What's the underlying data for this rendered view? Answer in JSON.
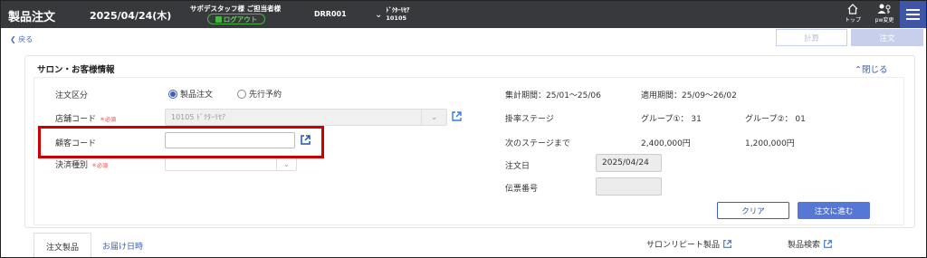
{
  "header": {
    "app_title": "製品注文",
    "date": "2025/04/24(木)",
    "staff": "サポデスタッフ様 ご担当者様",
    "logout_label": "ログアウト",
    "code": "DRR001",
    "store_name": "ﾄﾞｸﾀｰﾘｾｱ",
    "store_code": "10105",
    "home_label": "トップ",
    "pw_label": "pw変更",
    "colors": {
      "bar": "#37393c",
      "menu": "#3f55a8",
      "logout": "#46b640"
    }
  },
  "toolbar": {
    "back_label": "戻る",
    "calc_label": "計算",
    "order_label": "注文"
  },
  "salon_panel": {
    "title": "サロン・お客様情報",
    "collapse_label": "閉じる",
    "order_type": {
      "label": "注文区分",
      "options": [
        {
          "label": "製品注文",
          "selected": true
        },
        {
          "label": "先行予約",
          "selected": false
        }
      ]
    },
    "store_code": {
      "label": "店舗コード",
      "required": "必須",
      "value": "10105 ﾄﾞｸﾀｰﾘｾｱ"
    },
    "customer_code": {
      "label": "顧客コード",
      "value": ""
    },
    "payment_type": {
      "label": "決済種別",
      "required": "必須",
      "value": ""
    },
    "summary": {
      "aggregate_period": "集計期間：25/01～25/06",
      "applicable_period": "適用期間：25/09～26/02",
      "rate_stage_label": "掛率ステージ",
      "group1": "グループ①：  31",
      "group2": "グループ②：  01",
      "next_stage_label": "次のステージまで",
      "next_stage_amount1": "2,400,000円",
      "next_stage_amount2": "1,200,000円",
      "order_date_label": "注文日",
      "order_date": "2025/04/24",
      "slip_number_label": "伝票番号",
      "slip_number": ""
    },
    "clear_label": "クリア",
    "next_label": "注文に進む",
    "colors": {
      "highlight": "#cc0000",
      "primary": "#5578d6",
      "link": "#3a60b8",
      "required": "#e04040"
    }
  },
  "tabs": [
    {
      "label": "注文製品",
      "active": true
    },
    {
      "label": "お届け日時",
      "active": false
    }
  ],
  "bottom_links": {
    "repeat_label": "サロンリピート製品",
    "search_label": "製品検索"
  }
}
